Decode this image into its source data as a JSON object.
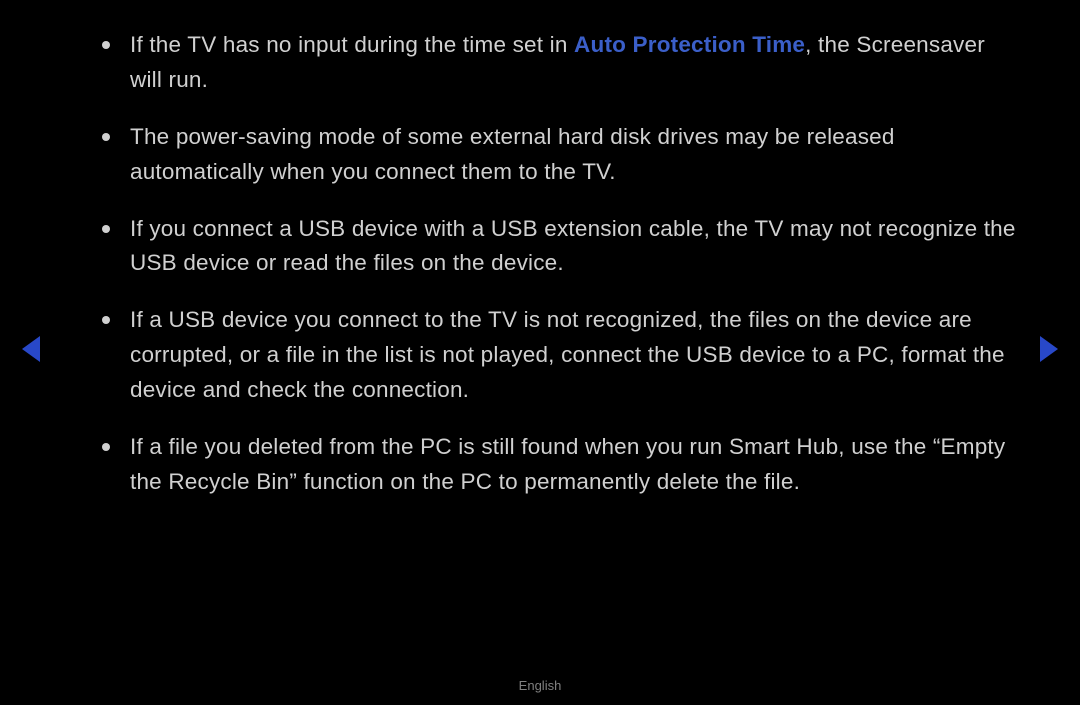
{
  "bullets": [
    {
      "pre": "If the TV has no input during the time set in ",
      "highlight": "Auto Protection Time",
      "post": ", the Screensaver will run."
    },
    {
      "pre": "The power-saving mode of some external hard disk drives may be released automatically when you connect them to the TV.",
      "highlight": "",
      "post": ""
    },
    {
      "pre": "If you connect a USB device with a USB extension cable, the TV may not recognize the USB device or read the files on the device.",
      "highlight": "",
      "post": ""
    },
    {
      "pre": "If a USB device you connect to the TV is not recognized, the files on the device are corrupted, or a file in the list is not played, connect the USB device to a PC, format the device and check the connection.",
      "highlight": "",
      "post": ""
    },
    {
      "pre": "If a file you deleted from the PC is still found when you run Smart Hub, use the “Empty the Recycle Bin” function on the PC to permanently delete the file.",
      "highlight": "",
      "post": ""
    }
  ],
  "footer": "English"
}
